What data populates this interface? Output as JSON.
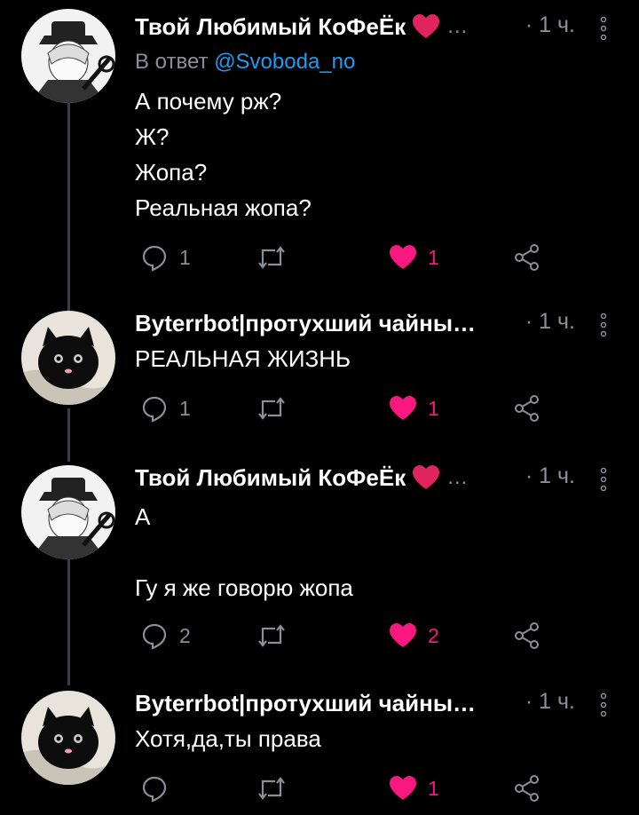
{
  "tweets": [
    {
      "name": "Твой Любимый КоФеЁк",
      "ellipsis": "…",
      "time": "· 1 ч.",
      "reply_prefix": "В ответ",
      "reply_handle": "@Svoboda_no",
      "text": "А почему рж?\nЖ?\nЖопа?\nРеальная жопа?",
      "replies": "1",
      "retweets": "",
      "likes": "1"
    },
    {
      "name": "Byterrbot|протухший чайны…",
      "time": "· 1 ч.",
      "text": "РЕАЛЬНАЯ ЖИЗНЬ",
      "replies": "1",
      "retweets": "",
      "likes": "1"
    },
    {
      "name": "Твой Любимый КоФеЁк",
      "ellipsis": "…",
      "time": "· 1 ч.",
      "text": "А\n\nГу я же говорю жопа",
      "replies": "2",
      "retweets": "",
      "likes": "2"
    },
    {
      "name": "Byterrbot|протухший чайны…",
      "time": "· 1 ч.",
      "text": "Хотя,да,ты права",
      "replies": "",
      "retweets": "",
      "likes": "1"
    }
  ],
  "colors": {
    "like": "#f91880",
    "muted": "#8b9095",
    "link": "#1d9bf0",
    "bg": "#000000"
  },
  "icons": [
    "reply-icon",
    "retweet-icon",
    "heart-icon",
    "share-icon",
    "more-icon"
  ]
}
